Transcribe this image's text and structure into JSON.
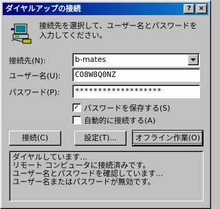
{
  "window": {
    "title": "ダイヤルアップの接続",
    "help_button": "?",
    "close_button": "×"
  },
  "description": "接続先を選択して、ユーザー名とパスワードを入力してください。",
  "form": {
    "connect_to_label": "接続先(N):",
    "connect_to_value": "b-mates",
    "username_label": "ユーザー名(U):",
    "username_value": "CO8W8Q0NZ",
    "password_label": "パスワード(P):",
    "password_value": "*******************"
  },
  "checkboxes": {
    "save_password": {
      "label": "パスワードを保存する(S)",
      "checked": true,
      "mark": "✓"
    },
    "auto_connect": {
      "label": "自動的に接続する(A)",
      "checked": false,
      "mark": ""
    }
  },
  "buttons": {
    "connect": "接続(C)",
    "settings": "設定(T)...",
    "work_offline": "オフライン作業(O)"
  },
  "status_lines": [
    "ダイヤルしています...",
    "リモート コンピュータに接続済みです。",
    "ユーザー名とパスワードを確認しています...",
    "ユーザー名またはパスワードが無効です。"
  ]
}
